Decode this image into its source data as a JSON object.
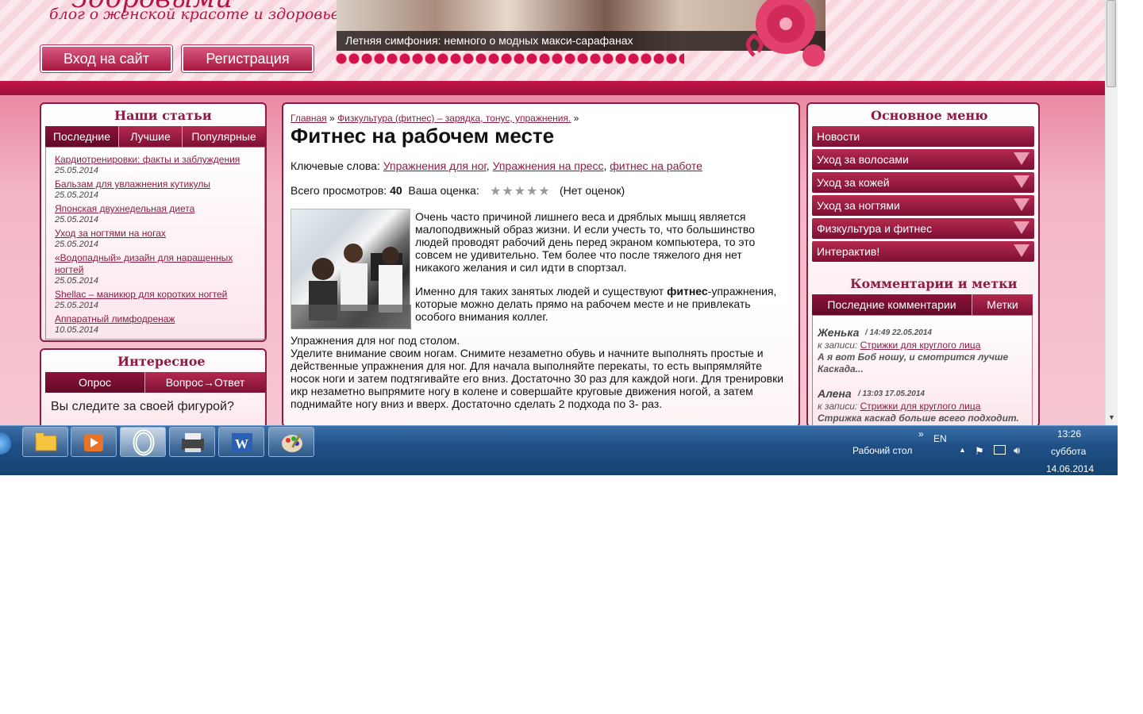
{
  "header": {
    "logo_title": "Здоровыми",
    "logo_subtitle": "блог о женской красоте и здоровье",
    "login_button": "Вход на сайт",
    "register_button": "Регистрация",
    "slider_caption": "Летняя симфония: немного о модных макси-сарафанах"
  },
  "left": {
    "articles_title": "Наши статьи",
    "tabs": [
      "Последние",
      "Лучшие",
      "Популярные"
    ],
    "articles": [
      {
        "title": "Кардиотренировки: факты и заблуждения",
        "date": "25.05.2014"
      },
      {
        "title": "Бальзам для увлажнения кутикулы",
        "date": "25.05.2014"
      },
      {
        "title": "Японская двухнедельная диета",
        "date": "25.05.2014"
      },
      {
        "title": "Уход за ногтями на ногах",
        "date": "25.05.2014"
      },
      {
        "title_line1": "«Водопадный» дизайн для наращенных",
        "title_line2": "ногтей",
        "date": "25.05.2014"
      },
      {
        "title": "Shellac – маникюр для коротких ногтей",
        "date": "25.05.2014"
      },
      {
        "title": "Аппаратный лимфодренаж",
        "date": "10.05.2014"
      }
    ],
    "interesting_title": "Интересное",
    "interesting_tabs": [
      "Опрос",
      "Вопрос→Ответ"
    ],
    "poll_question": "Вы следите за своей фигурой?"
  },
  "center": {
    "breadcrumb_home": "Главная",
    "breadcrumb_sep": "»",
    "breadcrumb_category": "Физкультура (фитнес) – зарядка, тонус, упражнения.",
    "title": "Фитнес на рабочем месте",
    "keywords_label": "Ключевые слова:",
    "keywords": [
      "Упражнения для ног",
      "Упражнения на пресс",
      "фитнес на работе"
    ],
    "views_label": "Всего просмотров:",
    "views": "40",
    "rating_label": "Ваша оценка:",
    "rating_note": "(Нет оценок)",
    "rating_stars": 5,
    "para1": "Очень часто причиной лишнего веса и дряблых мышц является малоподвижный образ жизни. И если учесть то, что большинство людей проводят рабочий день перед экраном компьютера, то это совсем не удивительно. Тем более что после тяжелого дня нет никакого желания и сил идти в спортзал.",
    "para2_before": "Именно для таких занятых людей и существуют ",
    "para2_bold": "фитнес",
    "para2_after": "-упражнения, которые можно делать прямо на рабочем месте и не привлекать особого внимания коллег.",
    "section_title": "Упражнения для ног под столом.",
    "para3": "Уделите внимание своим ногам. Снимите незаметно обувь и начните выполнять простые и действенные упражнения для ног. Для начала выполняйте перекаты, то есть выпрямляйте носок ноги и затем подтягивайте его вниз. Достаточно 30 раз для каждой ноги. Для тренировки икр незаметно выпрямите ногу в колене и совершайте круговые движения ногой, а затем поднимайте ногу вниз и вверх. Достаточно сделать 2 подхода по 3- раз."
  },
  "right": {
    "menu_title": "Основное меню",
    "menu_items": [
      "Новости",
      "Уход за волосами",
      "Уход за кожей",
      "Уход за ногтями",
      "Физкультура и фитнес",
      "Интерактив!"
    ],
    "comments_title": "Комментарии и метки",
    "comments_tabs": [
      "Последние комментарии",
      "Метки"
    ],
    "comments": [
      {
        "name": "Женька",
        "meta": "/ 14:49 22.05.2014",
        "record_label": "к записи:",
        "record_link": "Стрижки для круглого лица",
        "body": "А я вот Боб ношу, и смотрится лучше Каскада..."
      },
      {
        "name": "Алена",
        "meta": "/ 13:03 17.05.2014",
        "record_label": "к записи:",
        "record_link": "Стрижки для круглого лица",
        "body": "Стрижка каскад больше всего подходит."
      }
    ]
  },
  "taskbar": {
    "desktop_label": "Рабочий стол",
    "lang": "EN",
    "time": "13:26",
    "day": "суббота",
    "date": "14.06.2014",
    "pinned": [
      "explorer-icon",
      "media-player-icon",
      "opera-icon",
      "printer-icon",
      "word-icon",
      "paint-icon"
    ]
  }
}
